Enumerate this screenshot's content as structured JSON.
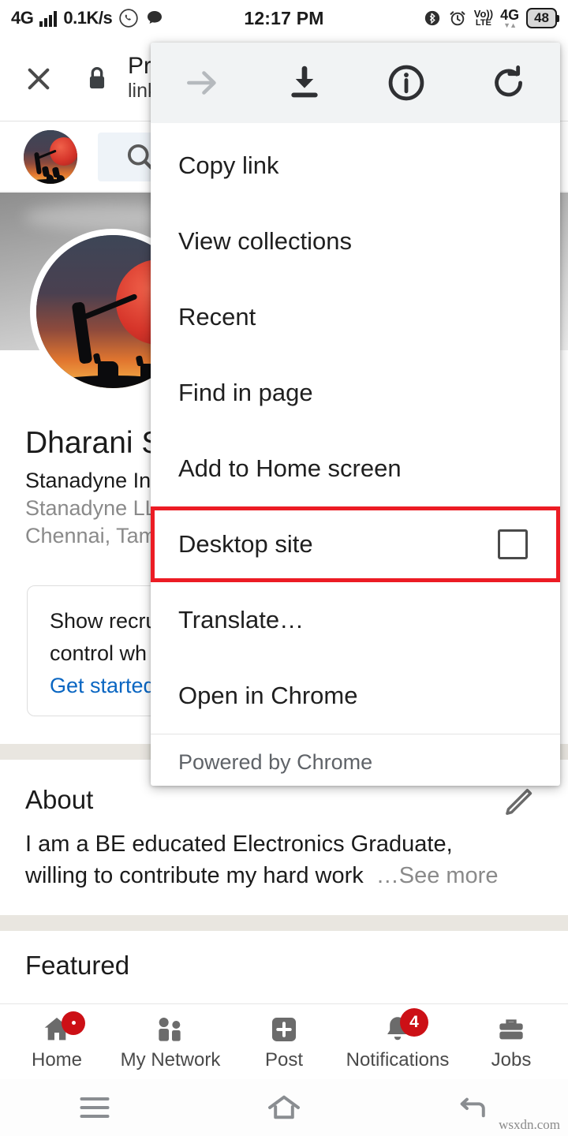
{
  "status_bar": {
    "network_type": "4G",
    "data_speed": "0.1K/s",
    "time": "12:17 PM",
    "volte_top": "Vo))",
    "volte_bottom": "LTE",
    "network_type_right": "4G",
    "battery_level": "48",
    "icons": [
      "signal-bars-icon",
      "whatsapp-icon",
      "message-icon",
      "bluetooth-icon",
      "alarm-icon"
    ]
  },
  "custom_tab": {
    "close_label": "×",
    "lock_icon": "lock-icon",
    "title": "Pro",
    "url": "linke"
  },
  "linkedin_appbar": {
    "avatar_name": "user-avatar",
    "search_icon": "search-icon"
  },
  "profile": {
    "name": "Dharani S",
    "headline": "Stanadyne In",
    "company": "Stanadyne LL",
    "location": "Chennai, Tam"
  },
  "recruiter_card": {
    "line1": "Show recru",
    "line2": "control wh",
    "cta": "Get started"
  },
  "about": {
    "title": "About",
    "edit_icon": "pencil-icon",
    "line1": "I am a BE educated Electronics Graduate,",
    "line2": "willing to contribute my hard work",
    "see_more": "…See more"
  },
  "featured": {
    "title": "Featured"
  },
  "bottom_nav": {
    "items": [
      {
        "label": "Home",
        "icon": "home-icon",
        "badge": "",
        "badge_type": "dot"
      },
      {
        "label": "My Network",
        "icon": "people-icon",
        "badge": "",
        "badge_type": "none"
      },
      {
        "label": "Post",
        "icon": "plus-square-icon",
        "badge": "",
        "badge_type": "none"
      },
      {
        "label": "Notifications",
        "icon": "bell-icon",
        "badge": "4",
        "badge_type": "count"
      },
      {
        "label": "Jobs",
        "icon": "briefcase-icon",
        "badge": "",
        "badge_type": "none"
      }
    ]
  },
  "android_nav": {
    "recents_icon": "menu-lines-icon",
    "home_icon": "home-outline-icon",
    "back_icon": "back-arrow-icon"
  },
  "chrome_menu": {
    "toolbar": [
      {
        "name": "forward-arrow-icon",
        "label": "Forward",
        "disabled": true
      },
      {
        "name": "download-icon",
        "label": "Download",
        "disabled": false
      },
      {
        "name": "info-icon",
        "label": "Page info",
        "disabled": false
      },
      {
        "name": "reload-icon",
        "label": "Reload",
        "disabled": false
      }
    ],
    "items": [
      {
        "label": "Copy link",
        "highlighted": false,
        "checkbox": false
      },
      {
        "label": "View collections",
        "highlighted": false,
        "checkbox": false
      },
      {
        "label": "Recent",
        "highlighted": false,
        "checkbox": false
      },
      {
        "label": "Find in page",
        "highlighted": false,
        "checkbox": false
      },
      {
        "label": "Add to Home screen",
        "highlighted": false,
        "checkbox": false
      },
      {
        "label": "Desktop site",
        "highlighted": true,
        "checkbox": true,
        "checked": false
      },
      {
        "label": "Translate…",
        "highlighted": false,
        "checkbox": false
      },
      {
        "label": "Open in Chrome",
        "highlighted": false,
        "checkbox": false
      }
    ],
    "footer": "Powered by Chrome",
    "highlight_color": "#ec1c24"
  },
  "watermark": "wsxdn.com"
}
